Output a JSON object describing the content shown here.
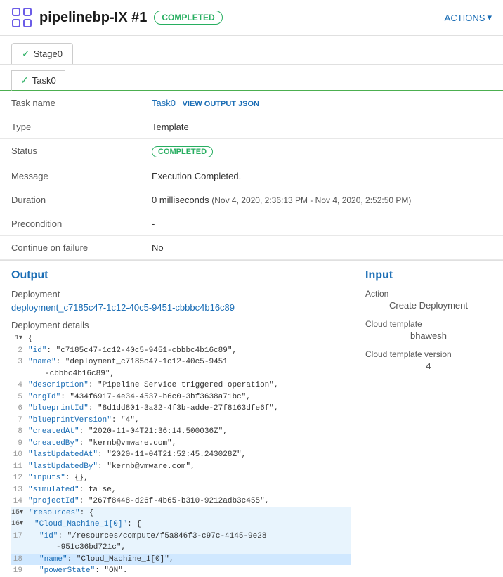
{
  "header": {
    "icon": "pipeline-icon",
    "title": "pipelinebp-IX #1",
    "status_badge": "COMPLETED",
    "actions_label": "ACTIONS"
  },
  "stage_tab": {
    "label": "Stage0",
    "active": true
  },
  "task_tab": {
    "label": "Task0"
  },
  "detail_rows": [
    {
      "label": "Task name",
      "task_name": "Task0",
      "view_json": "VIEW OUTPUT JSON"
    },
    {
      "label": "Type",
      "value": "Template"
    },
    {
      "label": "Status",
      "status": "COMPLETED"
    },
    {
      "label": "Message",
      "value": "Execution Completed."
    },
    {
      "label": "Duration",
      "value": "0 milliseconds",
      "duration_detail": "(Nov 4, 2020, 2:36:13 PM - Nov 4, 2020, 2:52:50 PM)"
    },
    {
      "label": "Precondition",
      "value": "-"
    },
    {
      "label": "Continue on failure",
      "value": "No"
    }
  ],
  "output": {
    "section_title": "Output",
    "deployment_label": "Deployment",
    "deployment_link": "deployment_c7185c47-1c12-40c5-9451-cbbbc4b16c89",
    "deployment_details_label": "Deployment details",
    "json_lines": [
      {
        "num": 1,
        "content": "{",
        "highlight": false
      },
      {
        "num": 2,
        "content": "  \"id\": \"c7185c47-1c12-40c5-9451-cbbbc4b16c89\",",
        "highlight": false
      },
      {
        "num": 3,
        "content": "  \"name\": \"deployment_c7185c47-1c12-40c5-9451",
        "highlight": false,
        "continuation": "    -cbbbc4b16c89\","
      },
      {
        "num": 4,
        "content": "  \"description\": \"Pipeline Service triggered operation\",",
        "highlight": false
      },
      {
        "num": 5,
        "content": "  \"orgId\": \"434f6917-4e34-4537-b6c0-3bf3638a71bc\",",
        "highlight": false
      },
      {
        "num": 6,
        "content": "  \"blueprintId\": \"8d1dd801-3a32-4f3b-adde-27f8163dfe6f\",",
        "highlight": false
      },
      {
        "num": 7,
        "content": "  \"blueprintVersion\": \"4\",",
        "highlight": false
      },
      {
        "num": 8,
        "content": "  \"createdAt\": \"2020-11-04T21:36:14.500036Z\",",
        "highlight": false
      },
      {
        "num": 9,
        "content": "  \"createdBy\": \"kernb@vmware.com\",",
        "highlight": false
      },
      {
        "num": 10,
        "content": "  \"lastUpdatedAt\": \"2020-11-04T21:52:45.243028Z\",",
        "highlight": false
      },
      {
        "num": 11,
        "content": "  \"lastUpdatedBy\": \"kernb@vmware.com\",",
        "highlight": false
      },
      {
        "num": 12,
        "content": "  \"inputs\": {},",
        "highlight": false
      },
      {
        "num": 13,
        "content": "  \"simulated\": false,",
        "highlight": false
      },
      {
        "num": 14,
        "content": "  \"projectId\": \"267f8448-d26f-4b65-b310-9212adb3c455\",",
        "highlight": false
      },
      {
        "num": 15,
        "content": "  \"resources\": {",
        "highlight": true
      },
      {
        "num": 16,
        "content": "    \"Cloud_Machine_1[0]\": {",
        "highlight": true
      },
      {
        "num": 17,
        "content": "      \"id\": \"/resources/compute/f5a846f3-c97c-4145-9e28",
        "highlight": true,
        "continuation": "        -951c36bd721c\","
      },
      {
        "num": 18,
        "content": "      \"name\": \"Cloud_Machine_1[0]\",",
        "highlight": true,
        "highlighted_yellow": true
      },
      {
        "num": 19,
        "content": "      \"powerState\": \"ON\".",
        "highlight": false
      }
    ]
  },
  "input": {
    "section_title": "Input",
    "action_label": "Action",
    "action_value": "Create Deployment",
    "cloud_template_label": "Cloud template",
    "cloud_template_value": "bhawesh",
    "cloud_template_version_label": "Cloud template version",
    "cloud_template_version_value": "4"
  }
}
